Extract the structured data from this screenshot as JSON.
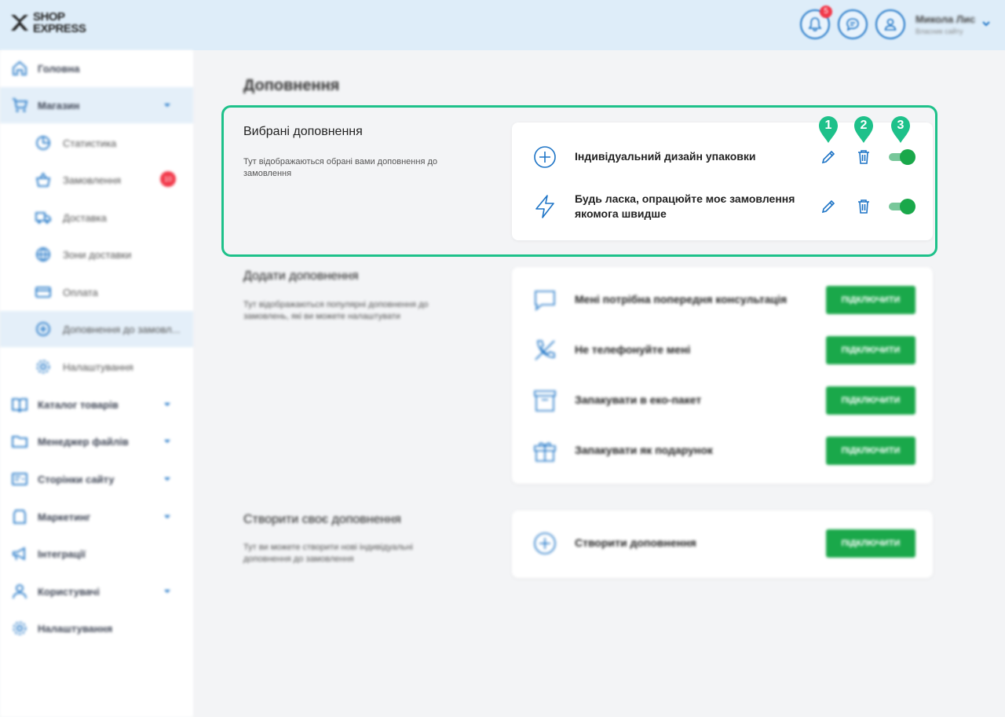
{
  "app": {
    "logo_line1": "SHOP",
    "logo_line2": "EXPRESS"
  },
  "header": {
    "notification_count": "5",
    "user_name": "Микола Лис",
    "user_role": "Власник сайту"
  },
  "sidebar": {
    "items": [
      {
        "label": "Головна",
        "icon": "home-icon"
      },
      {
        "label": "Магазин",
        "icon": "cart-icon"
      },
      {
        "label": "Статистика",
        "icon": "pie-chart-icon"
      },
      {
        "label": "Замовлення",
        "icon": "basket-icon",
        "badge": "10"
      },
      {
        "label": "Доставка",
        "icon": "truck-icon"
      },
      {
        "label": "Зони доставки",
        "icon": "globe-icon"
      },
      {
        "label": "Оплата",
        "icon": "card-icon"
      },
      {
        "label": "Доповнення до замовл...",
        "icon": "plus-circle-icon"
      },
      {
        "label": "Налаштування",
        "icon": "gear-icon"
      },
      {
        "label": "Каталог товарів",
        "icon": "book-icon"
      },
      {
        "label": "Менеджер файлів",
        "icon": "folder-icon"
      },
      {
        "label": "Сторінки сайту",
        "icon": "pages-icon"
      },
      {
        "label": "Маркетинг",
        "icon": "tag-icon"
      },
      {
        "label": "Інтеграції",
        "icon": "megaphone-icon"
      },
      {
        "label": "Користувачі",
        "icon": "user-icon"
      },
      {
        "label": "Налаштування",
        "icon": "gear-icon"
      }
    ]
  },
  "main": {
    "title": "Доповнення",
    "selected": {
      "heading": "Вибрані доповнення",
      "description": "Тут відображаються обрані вами доповнення до замовлення",
      "items": [
        {
          "title": "Індивідуальний дизайн упаковки",
          "icon": "plus-circle-icon",
          "enabled": true
        },
        {
          "title": "Будь ласка, опрацюйте моє замовлення якомога швидше",
          "icon": "lightning-icon",
          "enabled": true
        }
      ]
    },
    "add": {
      "heading": "Додати доповнення",
      "description": "Тут відображаються популярні доповнення до замовлень, які ви можете налаштувати",
      "items": [
        {
          "title": "Мені потрібна попередня консультація",
          "icon": "chat-icon",
          "button": "ПІДКЛЮЧИТИ"
        },
        {
          "title": "Не телефонуйте мені",
          "icon": "phone-off-icon",
          "button": "ПІДКЛЮЧИТИ"
        },
        {
          "title": "Запакувати в еко-пакет",
          "icon": "box-icon",
          "button": "ПІДКЛЮЧИТИ"
        },
        {
          "title": "Запакувати як подарунок",
          "icon": "gift-icon",
          "button": "ПІДКЛЮЧИТИ"
        }
      ]
    },
    "create": {
      "heading": "Створити своє доповнення",
      "description": "Тут ви можете створити нові індивідуальні доповнення до замовлення",
      "item": {
        "title": "Створити доповнення",
        "icon": "plus-circle-icon",
        "button": "ПІДКЛЮЧИТИ"
      }
    }
  },
  "annotations": [
    "1",
    "2",
    "3"
  ],
  "colors": {
    "accent_blue": "#1d74c6",
    "green": "#1aa84a",
    "highlight": "#1ec18a",
    "badge_red": "#f2394a"
  }
}
